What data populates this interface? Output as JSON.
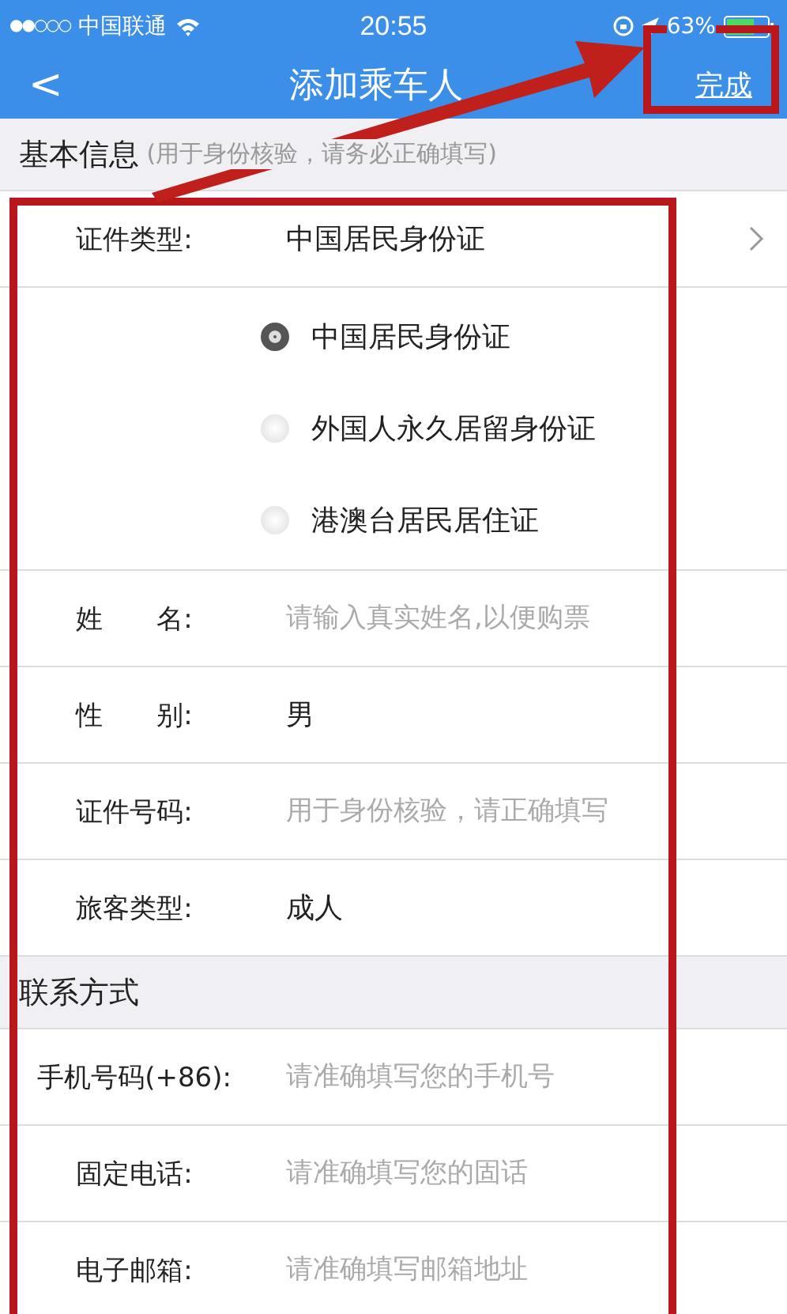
{
  "status_bar": {
    "signal": "●●○○○",
    "carrier": "中国联通",
    "time": "20:55",
    "battery": "63%"
  },
  "nav": {
    "back": "<",
    "title": "添加乘车人",
    "action": "完成"
  },
  "sections": [
    {
      "title": "基本信息",
      "note": "(用于身份核验，请务必正确填写)",
      "rows": [
        {
          "kind": "select",
          "label": "证件类型:",
          "value": "中国居民身份证",
          "options": [
            {
              "label": "中国居民身份证",
              "selected": true
            },
            {
              "label": "外国人永久居留身份证",
              "selected": false
            },
            {
              "label": "港澳台居民居住证",
              "selected": false
            }
          ]
        },
        {
          "kind": "input",
          "label": "姓　　名:",
          "placeholder": "请输入真实姓名,以便购票"
        },
        {
          "kind": "text",
          "label": "性　　别:",
          "value": "男"
        },
        {
          "kind": "input",
          "label": "证件号码:",
          "placeholder": "用于身份核验，请正确填写"
        },
        {
          "kind": "text",
          "label": "旅客类型:",
          "value": "成人"
        }
      ]
    },
    {
      "title": "联系方式",
      "rows": [
        {
          "kind": "input",
          "label": "手机号码(+86):",
          "placeholder": "请准确填写您的手机号"
        },
        {
          "kind": "input",
          "label": "固定电话:",
          "placeholder": "请准确填写您的固话"
        },
        {
          "kind": "input",
          "label": "电子邮箱:",
          "placeholder": "请准确填写邮箱地址"
        }
      ]
    }
  ]
}
